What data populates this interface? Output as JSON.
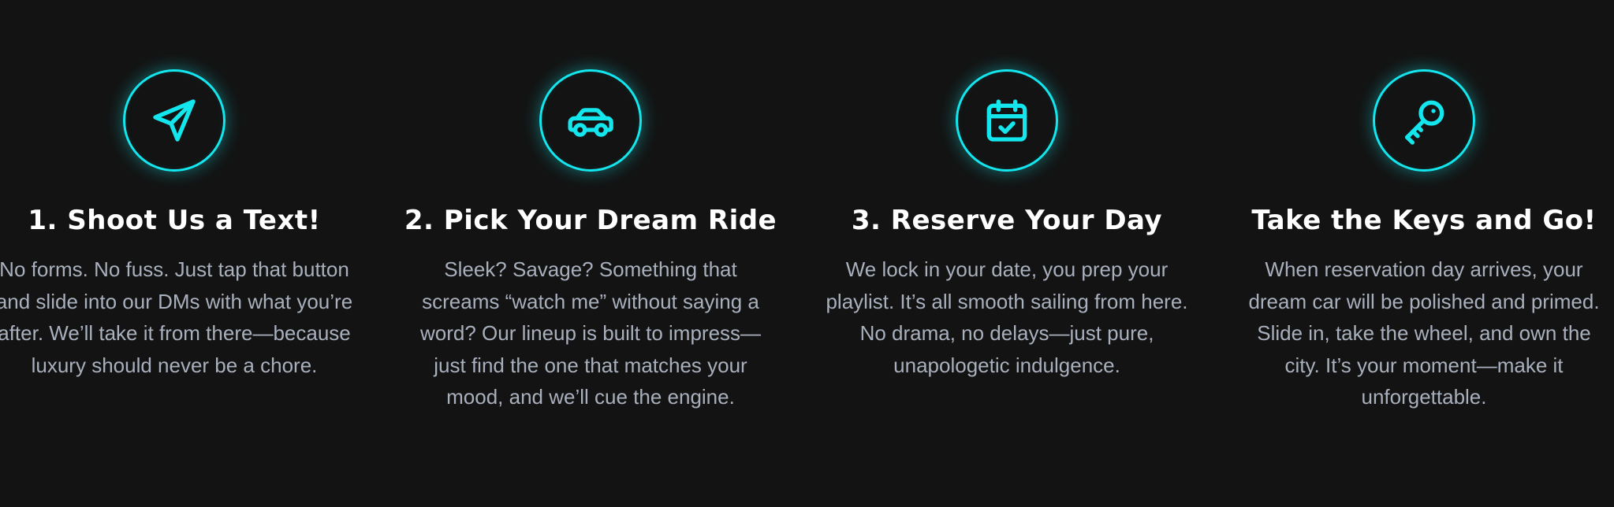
{
  "colors": {
    "background": "#131313",
    "accent": "#14e6ee",
    "title": "#ffffff",
    "body_text": "#a9b0bd"
  },
  "steps": [
    {
      "icon": "send-icon",
      "title": "1. Shoot Us a Text!",
      "description": "No forms. No fuss. Just tap that button and slide into our DMs with what you’re after. We’ll take it from there—because luxury should never be a chore."
    },
    {
      "icon": "car-icon",
      "title": "2. Pick Your Dream Ride",
      "description": "Sleek? Savage? Something that screams “watch me” without saying a word? Our lineup is built to impress—just find the one that matches your mood, and we’ll cue the engine."
    },
    {
      "icon": "calendar-check-icon",
      "title": "3. Reserve Your Day",
      "description": "We lock in your date, you prep your playlist. It’s all smooth sailing from here. No drama, no delays—just pure, unapologetic indulgence."
    },
    {
      "icon": "key-icon",
      "title": "Take the Keys and Go!",
      "description": "When reservation day arrives, your dream car will be polished and primed. Slide in, take the wheel, and own the city. It’s your moment—make it unforgettable."
    }
  ]
}
